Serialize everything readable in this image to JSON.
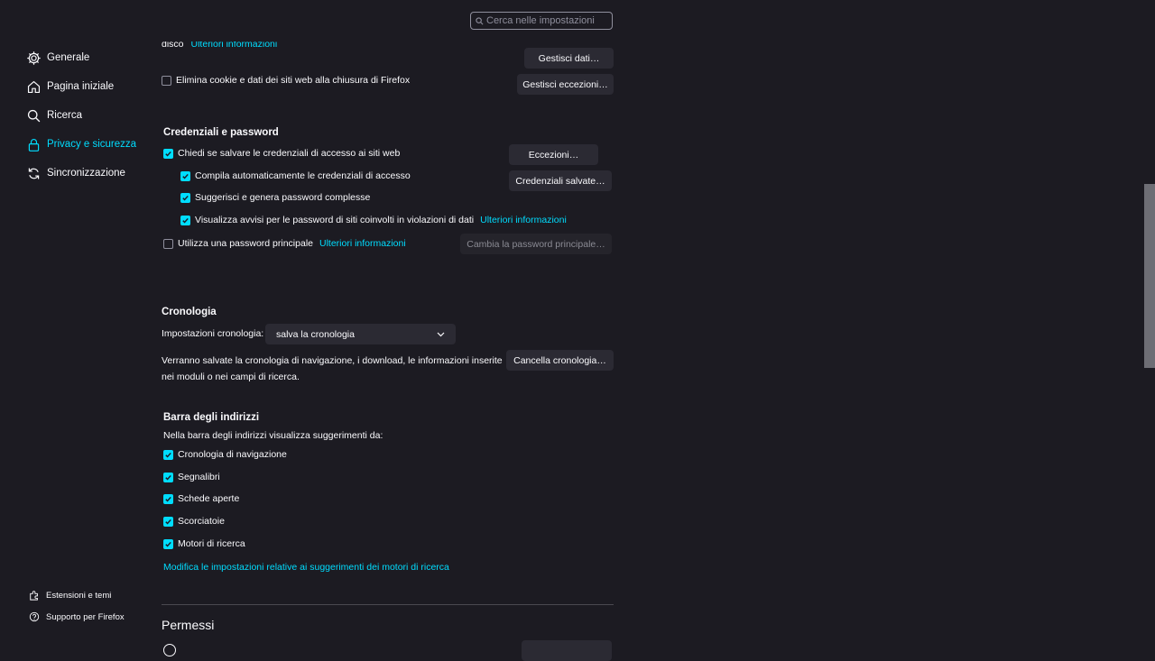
{
  "search": {
    "placeholder": "Cerca nelle impostazioni"
  },
  "sidebar": {
    "items": [
      {
        "label": "Generale",
        "icon": "gear-icon"
      },
      {
        "label": "Pagina iniziale",
        "icon": "home-icon"
      },
      {
        "label": "Ricerca",
        "icon": "search-icon"
      },
      {
        "label": "Privacy e sicurezza",
        "icon": "lock-icon",
        "active": true
      },
      {
        "label": "Sincronizzazione",
        "icon": "sync-icon"
      }
    ],
    "footer": [
      {
        "label": "Estensioni e temi",
        "icon": "puzzle-icon"
      },
      {
        "label": "Supporto per Firefox",
        "icon": "help-icon"
      }
    ]
  },
  "cookies": {
    "partial_text": "disco",
    "partial_link": "Ulteriori informazioni",
    "manage_data_button": "Gestisci dati…",
    "delete_on_close_label": "Elimina cookie e dati dei siti web alla chiusura di Firefox",
    "manage_exceptions_button": "Gestisci eccezioni…"
  },
  "credentials": {
    "title": "Credenziali e password",
    "ask_save": "Chiedi se salvare le credenziali di accesso ai siti web",
    "autofill": "Compila automaticamente le credenziali di accesso",
    "suggest": "Suggerisci e genera password complesse",
    "breach_alerts": "Visualizza avvisi per le password di siti coinvolti in violazioni di dati",
    "breach_link": "Ulteriori informazioni",
    "primary_password": "Utilizza una password principale",
    "primary_link": "Ulteriori informazioni",
    "exceptions_button": "Eccezioni…",
    "saved_button": "Credenziali salvate…",
    "change_primary_button": "Cambia la password principale…"
  },
  "history": {
    "title": "Cronologia",
    "settings_label": "Impostazioni cronologia:",
    "selected": "salva la cronologia",
    "description_line1": "Verranno salvate la cronologia di navigazione, i download, le informazioni inserite",
    "description_line2": "nei moduli o nei campi di ricerca.",
    "clear_button": "Cancella cronologia…"
  },
  "address_bar": {
    "title": "Barra degli indirizzi",
    "intro": "Nella barra degli indirizzi visualizza suggerimenti da:",
    "options": [
      "Cronologia di navigazione",
      "Segnalibri",
      "Schede aperte",
      "Scorciatoie",
      "Motori di ricerca"
    ],
    "link": "Modifica le impostazioni relative ai suggerimenti dei motori di ricerca"
  },
  "permissions": {
    "title": "Permessi"
  },
  "colors": {
    "accent": "#00ddff",
    "background": "#1c1b22",
    "button": "#2b2a33"
  }
}
